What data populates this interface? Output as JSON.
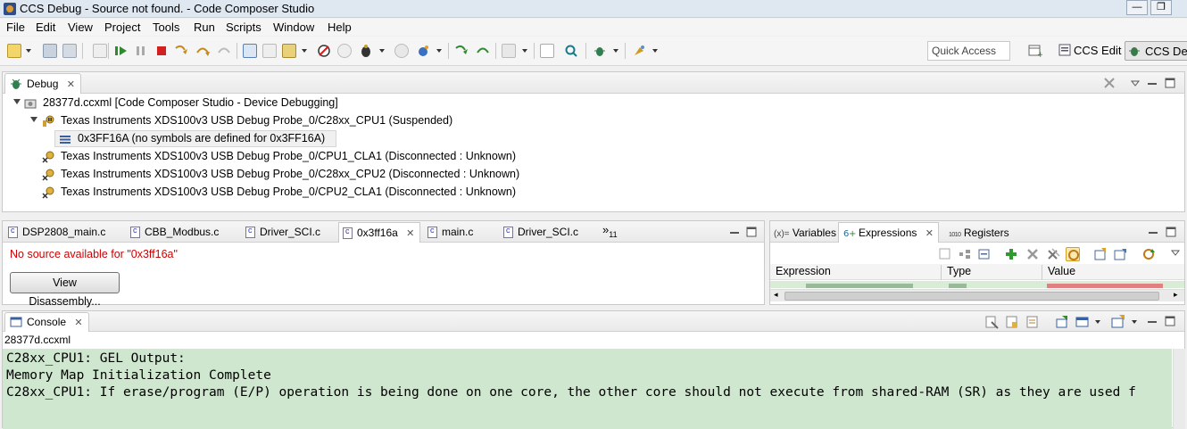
{
  "window": {
    "title": "CCS Debug - Source not found. - Code Composer Studio",
    "controls": [
      "—",
      "❐"
    ]
  },
  "menubar": {
    "items": [
      "File",
      "Edit",
      "View",
      "Project",
      "Tools",
      "Run",
      "Scripts",
      "Window",
      "Help"
    ]
  },
  "toolbar": {
    "quick_access_placeholder": "Quick Access",
    "perspectives": [
      "CCS Edit",
      "CCS Debug"
    ]
  },
  "debug_view": {
    "tab_label": "Debug",
    "tree": [
      {
        "label": "28377d.ccxml [Code Composer Studio - Device Debugging]"
      },
      {
        "label": "Texas Instruments XDS100v3 USB Debug Probe_0/C28xx_CPU1 (Suspended)"
      },
      {
        "label": "0x3FF16A  (no symbols are defined for 0x3FF16A)"
      },
      {
        "label": "Texas Instruments XDS100v3 USB Debug Probe_0/CPU1_CLA1 (Disconnected : Unknown)"
      },
      {
        "label": "Texas Instruments XDS100v3 USB Debug Probe_0/C28xx_CPU2 (Disconnected : Unknown)"
      },
      {
        "label": "Texas Instruments XDS100v3 USB Debug Probe_0/CPU2_CLA1 (Disconnected : Unknown)"
      }
    ]
  },
  "editor": {
    "tabs": [
      {
        "label": "DSP2808_main.c"
      },
      {
        "label": "CBB_Modbus.c"
      },
      {
        "label": "Driver_SCI.c"
      },
      {
        "label": "0x3ff16a"
      },
      {
        "label": "main.c"
      },
      {
        "label": "Driver_SCI.c"
      }
    ],
    "overflow_marker": "»",
    "overflow_count": "11",
    "no_source_message": "No source available for \"0x3ff16a\"",
    "view_disassembly_label": "View Disassembly..."
  },
  "right_panel": {
    "tabs": [
      {
        "prefix": "(x)=",
        "label": "Variables"
      },
      {
        "label": "Expressions"
      },
      {
        "prefix": "1010",
        "label": "Registers"
      }
    ],
    "columns": [
      "Expression",
      "Type",
      "Value"
    ]
  },
  "console": {
    "tab_label": "Console",
    "name": "28377d.ccxml",
    "lines": [
      "C28xx_CPU1: GEL Output:",
      "Memory Map Initialization Complete",
      "C28xx_CPU1: If erase/program (E/P) operation is being done on one core, the other core should not execute from shared-RAM (SR) as they are used f"
    ]
  },
  "colors": {
    "accent_blue": "#2d4e8a",
    "error_red": "#d00000",
    "console_background": "#cfe6cf"
  }
}
